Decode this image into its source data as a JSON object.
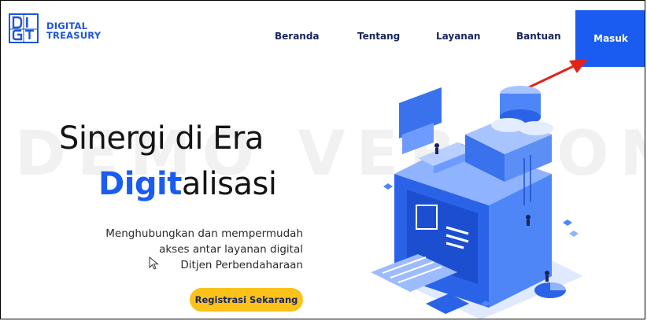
{
  "header": {
    "logo_line1": "DIGITAL",
    "logo_line2": "TREASURY",
    "nav": [
      "Beranda",
      "Tentang",
      "Layanan",
      "Bantuan"
    ],
    "login_label": "Masuk"
  },
  "hero": {
    "title_line1": "Sinergi di Era",
    "title_accent": "Digit",
    "title_rest": "alisasi",
    "subtitle": [
      "Menghubungkan dan mempermudah",
      "akses antar layanan digital",
      "Ditjen Perbendaharaan"
    ],
    "cta_label": "Registrasi Sekarang"
  },
  "watermark": "DEMO VERSION",
  "colors": {
    "brand_blue": "#1a5cf0",
    "nav_text": "#1a2560",
    "cta_yellow": "#fbc21a",
    "arrow_red": "#e0241c"
  },
  "icons": [
    "digit-logo-icon",
    "mouse-cursor-icon",
    "red-arrow-annotation"
  ]
}
